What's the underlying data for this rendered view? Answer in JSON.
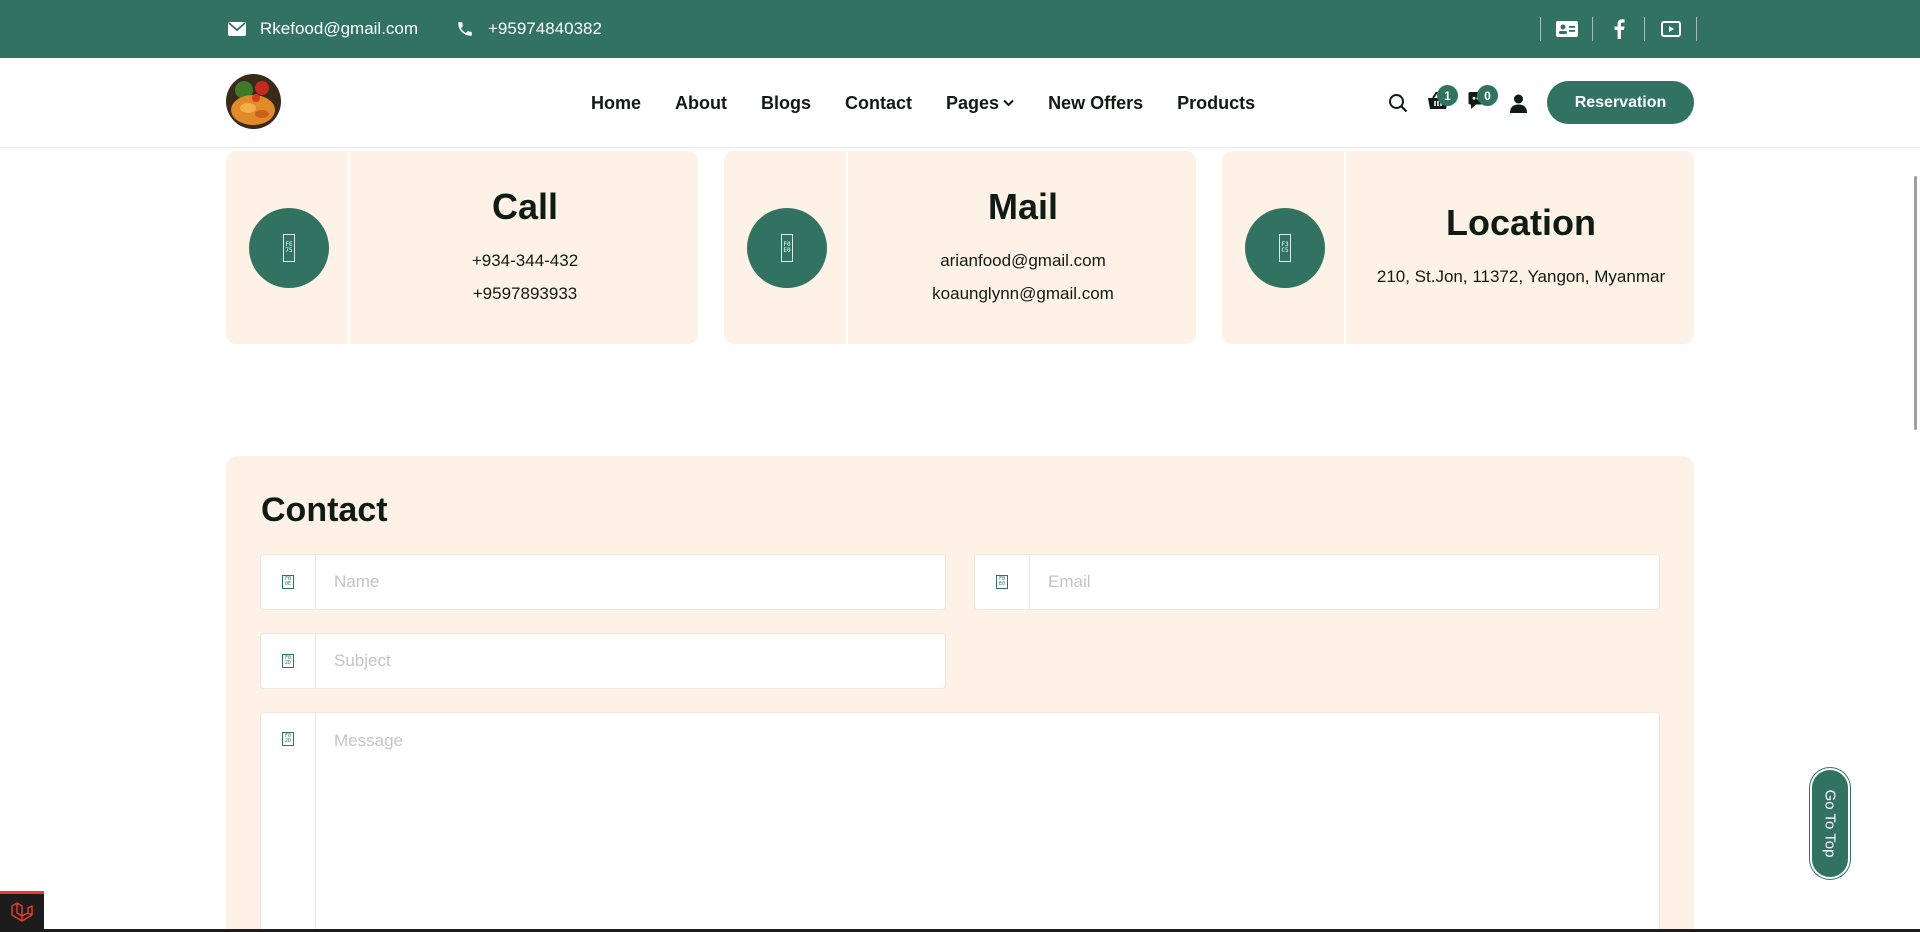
{
  "topbar": {
    "email": "Rkefood@gmail.com",
    "phone": "+95974840382",
    "socials": [
      "contact-card-icon",
      "facebook-icon",
      "youtube-icon"
    ]
  },
  "header": {
    "nav": [
      "Home",
      "About",
      "Blogs",
      "Contact",
      "Pages",
      "New Offers",
      "Products"
    ],
    "cart_count": "1",
    "message_count": "0",
    "reservation_label": "Reservation"
  },
  "info_cards": [
    {
      "title": "Call",
      "lines": [
        "+934-344-432",
        "+9597893933"
      ],
      "icon": "phone-icon"
    },
    {
      "title": "Mail",
      "lines": [
        "arianfood@gmail.com",
        "koaunglynn@gmail.com"
      ],
      "icon": "mail-icon"
    },
    {
      "title": "Location",
      "lines": [
        "210, St.Jon, 11372, Yangon, Myanmar"
      ],
      "icon": "location-icon"
    }
  ],
  "contact_form": {
    "title": "Contact",
    "name_placeholder": "Name",
    "email_placeholder": "Email",
    "subject_placeholder": "Subject",
    "message_placeholder": "Message"
  },
  "go_top_label": "Go To Top",
  "colors": {
    "primary": "#317360",
    "card_bg": "#fef1e6",
    "text": "#0f1b15"
  }
}
